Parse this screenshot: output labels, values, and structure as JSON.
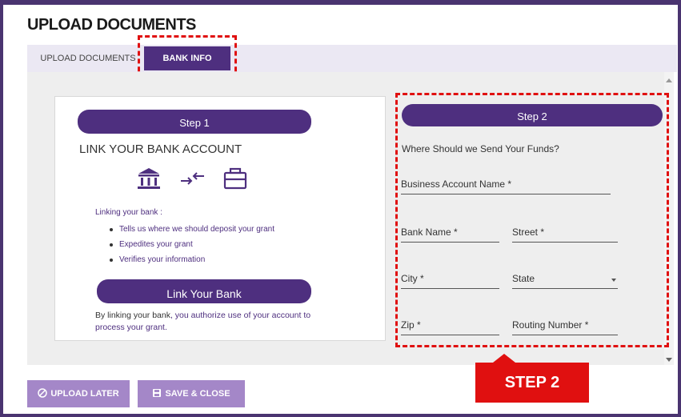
{
  "header": {
    "title": "UPLOAD DOCUMENTS"
  },
  "tabs": [
    {
      "label": "UPLOAD DOCUMENTS",
      "active": false
    },
    {
      "label": "BANK INFO",
      "active": true
    }
  ],
  "step1": {
    "pill_label": "Step 1",
    "heading": "LINK YOUR BANK ACCOUNT",
    "icons": [
      "bank-icon",
      "transfer-arrows-icon",
      "briefcase-icon"
    ],
    "linking_label": "Linking your bank :",
    "bullets": [
      "Tells us where we should deposit your grant",
      "Expedites your grant",
      "Verifies your information"
    ],
    "link_button": "Link Your Bank",
    "authorize_prefix": "By linking your bank",
    "authorize_rest": ", you authorize use of your account to process your grant."
  },
  "step2": {
    "pill_label": "Step 2",
    "question": "Where Should we Send Your Funds?",
    "fields": {
      "business_account_name": "Business Account Name *",
      "bank_name": "Bank Name *",
      "street": "Street *",
      "city": "City *",
      "state": "State",
      "zip": "Zip *",
      "routing_number": "Routing Number *"
    }
  },
  "callout": {
    "label": "STEP 2"
  },
  "footer": {
    "upload_later": "UPLOAD LATER",
    "save_close": "SAVE & CLOSE"
  },
  "colors": {
    "brand_purple": "#4e2f7f",
    "button_lavender": "#a487c8",
    "annotation_red": "#e01010"
  }
}
